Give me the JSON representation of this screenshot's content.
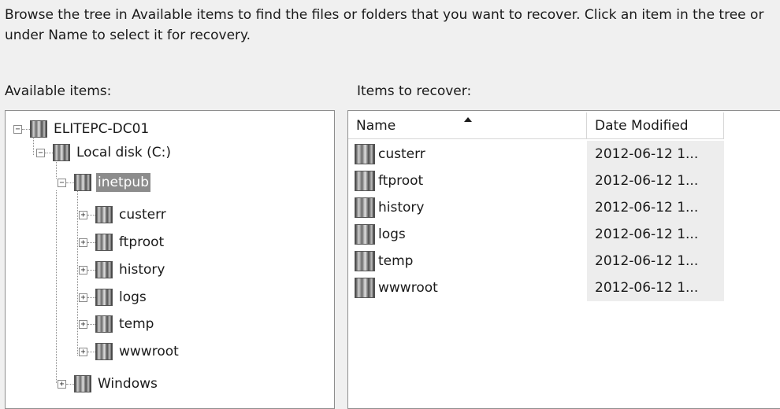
{
  "instructions": "Browse the tree in Available items to find the files or folders that you want to recover. Click an item in the tree or under Name to select it for recovery.",
  "available_label": "Available items:",
  "recover_label": "Items to recover:",
  "tree": {
    "root": {
      "label": "ELITEPC-DC01",
      "expander": "−"
    },
    "disk": {
      "label": "Local disk (C:)",
      "expander": "−"
    },
    "inetpub": {
      "label": "inetpub",
      "expander": "−",
      "selected": true
    },
    "children": [
      {
        "label": "custerr",
        "expander": "+"
      },
      {
        "label": "ftproot",
        "expander": "+"
      },
      {
        "label": "history",
        "expander": "+"
      },
      {
        "label": "logs",
        "expander": "+"
      },
      {
        "label": "temp",
        "expander": "+"
      },
      {
        "label": "wwwroot",
        "expander": "+"
      }
    ],
    "windows": {
      "label": "Windows",
      "expander": "+"
    }
  },
  "list": {
    "columns": {
      "name": "Name",
      "date": "Date Modified"
    },
    "sort": "name-ascending",
    "rows": [
      {
        "name": "custerr",
        "date": "2012-06-12 1..."
      },
      {
        "name": "ftproot",
        "date": "2012-06-12 1..."
      },
      {
        "name": "history",
        "date": "2012-06-12 1..."
      },
      {
        "name": "logs",
        "date": "2012-06-12 1..."
      },
      {
        "name": "temp",
        "date": "2012-06-12 1..."
      },
      {
        "name": "wwwroot",
        "date": "2012-06-12 1..."
      }
    ]
  }
}
